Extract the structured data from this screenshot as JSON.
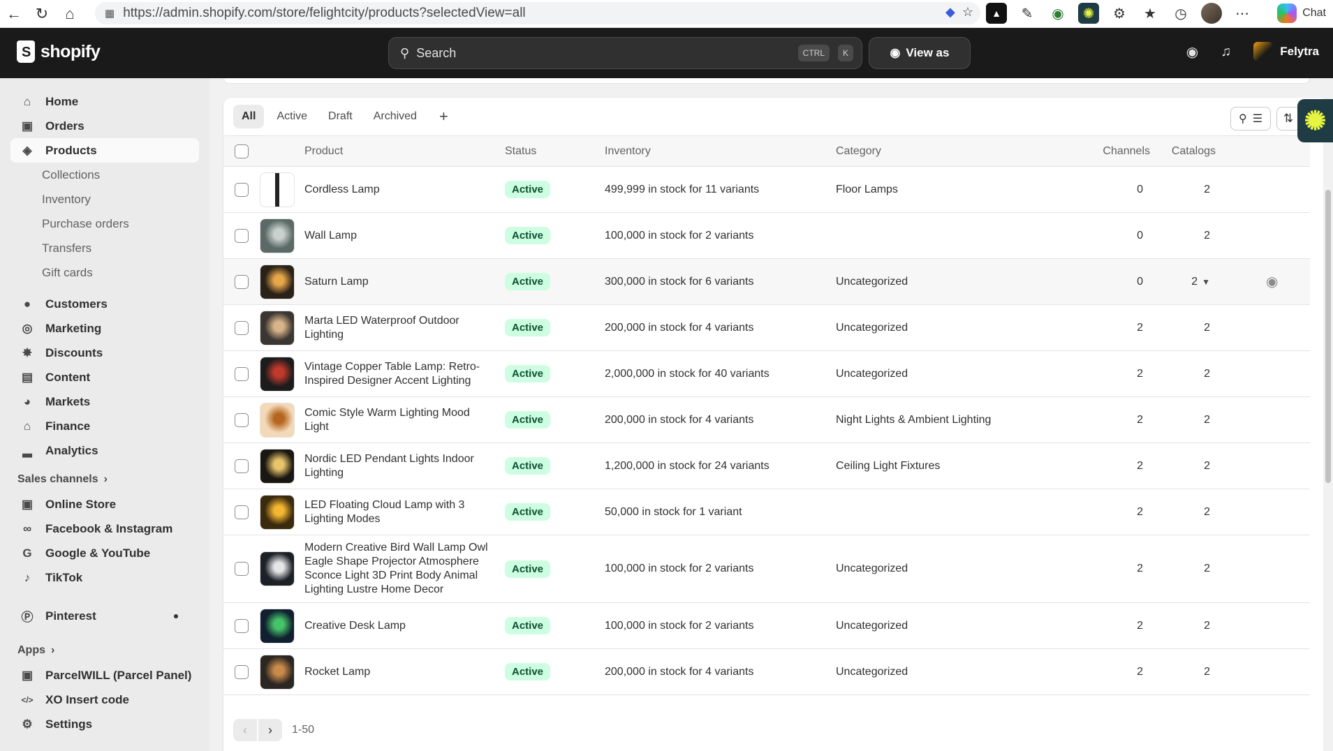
{
  "browser": {
    "url": "https://admin.shopify.com/store/felightcity/products?selectedView=all",
    "chat_label": "Chat"
  },
  "topbar": {
    "brand": "shopify",
    "search_placeholder": "Search",
    "shortcut_ctrl": "CTRL",
    "shortcut_key": "K",
    "view_as": "View as",
    "store_name": "Felytra"
  },
  "sidebar": {
    "main": [
      {
        "label": "Home",
        "icon": "home-icon"
      },
      {
        "label": "Orders",
        "icon": "orders-icon"
      },
      {
        "label": "Products",
        "icon": "tag-icon",
        "active": true
      }
    ],
    "product_sub": [
      "Collections",
      "Inventory",
      "Purchase orders",
      "Transfers",
      "Gift cards"
    ],
    "more": [
      {
        "label": "Customers",
        "icon": "person-icon"
      },
      {
        "label": "Marketing",
        "icon": "target-icon"
      },
      {
        "label": "Discounts",
        "icon": "discount-icon"
      },
      {
        "label": "Content",
        "icon": "content-icon"
      },
      {
        "label": "Markets",
        "icon": "globe-icon"
      },
      {
        "label": "Finance",
        "icon": "bank-icon"
      },
      {
        "label": "Analytics",
        "icon": "bar-chart-icon"
      }
    ],
    "sales_channels_label": "Sales channels",
    "channels": [
      {
        "label": "Online Store",
        "icon": "store-icon"
      },
      {
        "label": "Facebook & Instagram",
        "icon": "meta-icon"
      },
      {
        "label": "Google & YouTube",
        "icon": "google-icon"
      },
      {
        "label": "TikTok",
        "icon": "tiktok-icon"
      }
    ],
    "pinterest": "Pinterest",
    "apps_label": "Apps",
    "apps": [
      {
        "label": "ParcelWILL (Parcel Panel)",
        "icon": "parcel-icon"
      },
      {
        "label": "XO Insert code",
        "icon": "code-icon"
      }
    ],
    "settings": "Settings"
  },
  "tabs": [
    "All",
    "Active",
    "Draft",
    "Archived"
  ],
  "tab_add": "+",
  "columns": {
    "product": "Product",
    "status": "Status",
    "inventory": "Inventory",
    "category": "Category",
    "channels": "Channels",
    "catalogs": "Catalogs"
  },
  "products": [
    {
      "name": "Cordless Lamp",
      "status": "Active",
      "stock": "499,999 in stock",
      "variants": " for 11 variants",
      "category": "Floor Lamps",
      "channels": "0",
      "catalogs": "2",
      "thumb": [
        "#ffffff",
        "#222222"
      ]
    },
    {
      "name": "Wall Lamp",
      "status": "Active",
      "stock": "100,000 in stock",
      "variants": " for 2 variants",
      "category": "",
      "channels": "0",
      "catalogs": "2",
      "thumb": [
        "#5b6a66",
        "#c9d2cf"
      ]
    },
    {
      "name": "Saturn Lamp",
      "status": "Active",
      "stock": "300,000 in stock",
      "variants": " for 6 variants",
      "category": "Uncategorized",
      "channels": "0",
      "catalogs": "2",
      "thumb": [
        "#2a2118",
        "#e8a64a"
      ]
    },
    {
      "name": "Marta LED Waterproof Outdoor Lighting",
      "status": "Active",
      "stock": "200,000 in stock",
      "variants": " for 4 variants",
      "category": "Uncategorized",
      "channels": "2",
      "catalogs": "2",
      "thumb": [
        "#3b3632",
        "#d8b48a"
      ]
    },
    {
      "name": "Vintage Copper Table Lamp: Retro-Inspired Designer Accent Lighting",
      "status": "Active",
      "stock": "2,000,000 in stock",
      "variants": " for 40 variants",
      "category": "Uncategorized",
      "channels": "2",
      "catalogs": "2",
      "thumb": [
        "#1c1c1c",
        "#c0392b"
      ]
    },
    {
      "name": "Comic Style Warm Lighting Mood Light",
      "status": "Active",
      "stock": "200,000 in stock",
      "variants": " for 4 variants",
      "category": "Night Lights & Ambient Lighting",
      "channels": "2",
      "catalogs": "2",
      "thumb": [
        "#f3d9b8",
        "#b5651d"
      ]
    },
    {
      "name": "Nordic LED Pendant Lights Indoor Lighting",
      "status": "Active",
      "stock": "1,200,000 in stock",
      "variants": " for 24 variants",
      "category": "Ceiling Light Fixtures",
      "channels": "2",
      "catalogs": "2",
      "thumb": [
        "#1a1712",
        "#e8c46a"
      ]
    },
    {
      "name": "LED Floating Cloud Lamp with 3 Lighting Modes",
      "status": "Active",
      "stock": "50,000 in stock",
      "variants": " for 1 variant",
      "category": "",
      "channels": "2",
      "catalogs": "2",
      "thumb": [
        "#3a2a0e",
        "#f5b731"
      ]
    },
    {
      "name": "Modern Creative Bird Wall Lamp Owl Eagle Shape Projector Atmosphere Sconce Light 3D Print Body Animal Lighting Lustre Home Decor",
      "status": "Active",
      "stock": "100,000 in stock",
      "variants": " for 2 variants",
      "category": "Uncategorized",
      "channels": "2",
      "catalogs": "2",
      "thumb": [
        "#1c2128",
        "#e6e6e6"
      ]
    },
    {
      "name": "Creative Desk Lamp",
      "status": "Active",
      "stock": "100,000 in stock",
      "variants": " for 2 variants",
      "category": "Uncategorized",
      "channels": "2",
      "catalogs": "2",
      "thumb": [
        "#102030",
        "#46c46a"
      ]
    },
    {
      "name": "Rocket Lamp",
      "status": "Active",
      "stock": "200,000 in stock",
      "variants": " for 4 variants",
      "category": "Uncategorized",
      "channels": "2",
      "catalogs": "2",
      "thumb": [
        "#2b2622",
        "#c98a4a"
      ]
    }
  ],
  "pagination": {
    "range": "1-50"
  }
}
